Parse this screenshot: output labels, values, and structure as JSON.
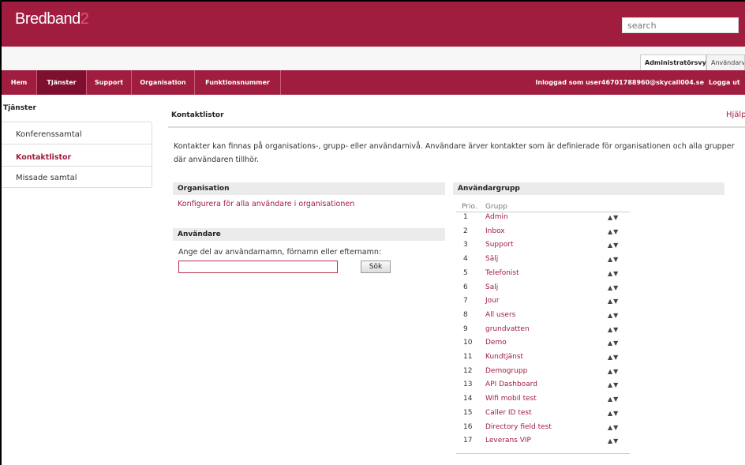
{
  "app": {
    "brand_main": "Bredband",
    "brand_suffix": "2",
    "search_placeholder": "search"
  },
  "view_tabs": [
    "Administratörsvy",
    "Användarvy"
  ],
  "nav": {
    "items": [
      "Hem",
      "Tjänster",
      "Support",
      "Organisation",
      "Funktionsnummer"
    ],
    "active": "Tjänster",
    "logged_in_text": "Inloggad som user46701788960@skycall004.se",
    "logout": "Logga ut"
  },
  "sidebar": {
    "title": "Tjänster",
    "items": [
      "Konferenssamtal",
      "Kontaktlistor",
      "Missade samtal"
    ],
    "active": "Kontaktlistor"
  },
  "main": {
    "title": "Kontaktlistor",
    "help": "Hjälp",
    "description": "Kontakter kan finnas på organisations-, grupp- eller användarnivå. Användare ärver kontakter som är definierade för organisationen och alla grupper där användaren tillhör.",
    "organisation": {
      "heading": "Organisation",
      "link": "Konfigurera för alla användare i organisationen"
    },
    "user": {
      "heading": "Användare",
      "prompt": "Ange del av användarnamn, förnamn eller efternamn:",
      "input_value": "",
      "search_button": "Sök"
    },
    "groups": {
      "heading": "Användargrupp",
      "col_prio": "Prio.",
      "col_group": "Grupp",
      "rows": [
        {
          "prio": "1",
          "name": "Admin"
        },
        {
          "prio": "2",
          "name": "Inbox"
        },
        {
          "prio": "3",
          "name": "Support"
        },
        {
          "prio": "4",
          "name": "Sälj"
        },
        {
          "prio": "5",
          "name": "Telefonist"
        },
        {
          "prio": "6",
          "name": "Salj"
        },
        {
          "prio": "7",
          "name": "Jour"
        },
        {
          "prio": "8",
          "name": "All users"
        },
        {
          "prio": "9",
          "name": "grundvatten"
        },
        {
          "prio": "10",
          "name": "Demo"
        },
        {
          "prio": "11",
          "name": "Kundtjänst"
        },
        {
          "prio": "12",
          "name": "Demogrupp"
        },
        {
          "prio": "13",
          "name": "API Dashboard"
        },
        {
          "prio": "14",
          "name": "Wifi mobil test"
        },
        {
          "prio": "15",
          "name": "Caller ID test"
        },
        {
          "prio": "16",
          "name": "Directory field test"
        },
        {
          "prio": "17",
          "name": "Leverans VIP"
        }
      ],
      "reorder_glyph": "▲▼"
    }
  },
  "colors": {
    "brand": "#a11d3f",
    "brand_dark": "#7e0f2e",
    "link": "#a11d3f"
  }
}
